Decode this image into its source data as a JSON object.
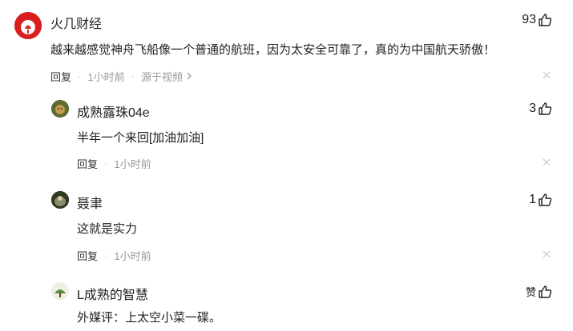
{
  "comments": [
    {
      "author": "火几财经",
      "text": "越来越感觉神舟飞船像一个普通的航班，因为太安全可靠了，真的为中国航天骄傲！",
      "reply_label": "回复",
      "time": "1小时前",
      "source": "源于视频",
      "likes": "93"
    },
    {
      "author": "成熟露珠04e",
      "text": "半年一个来回[加油加油]",
      "reply_label": "回复",
      "time": "1小时前",
      "likes": "3"
    },
    {
      "author": "聂聿",
      "text": "这就是实力",
      "reply_label": "回复",
      "time": "1小时前",
      "likes": "1"
    },
    {
      "author": "L成熟的智慧",
      "text": "外媒评：上太空小菜一碟。",
      "likes": "赞"
    }
  ],
  "meta": {
    "separator": "·"
  },
  "colors": {
    "brand_red": "#d81e1e",
    "meta_gray": "#999999"
  },
  "icons": {
    "like": "thumbs-up-icon",
    "close": "close-icon",
    "chevron": "chevron-right-icon"
  }
}
